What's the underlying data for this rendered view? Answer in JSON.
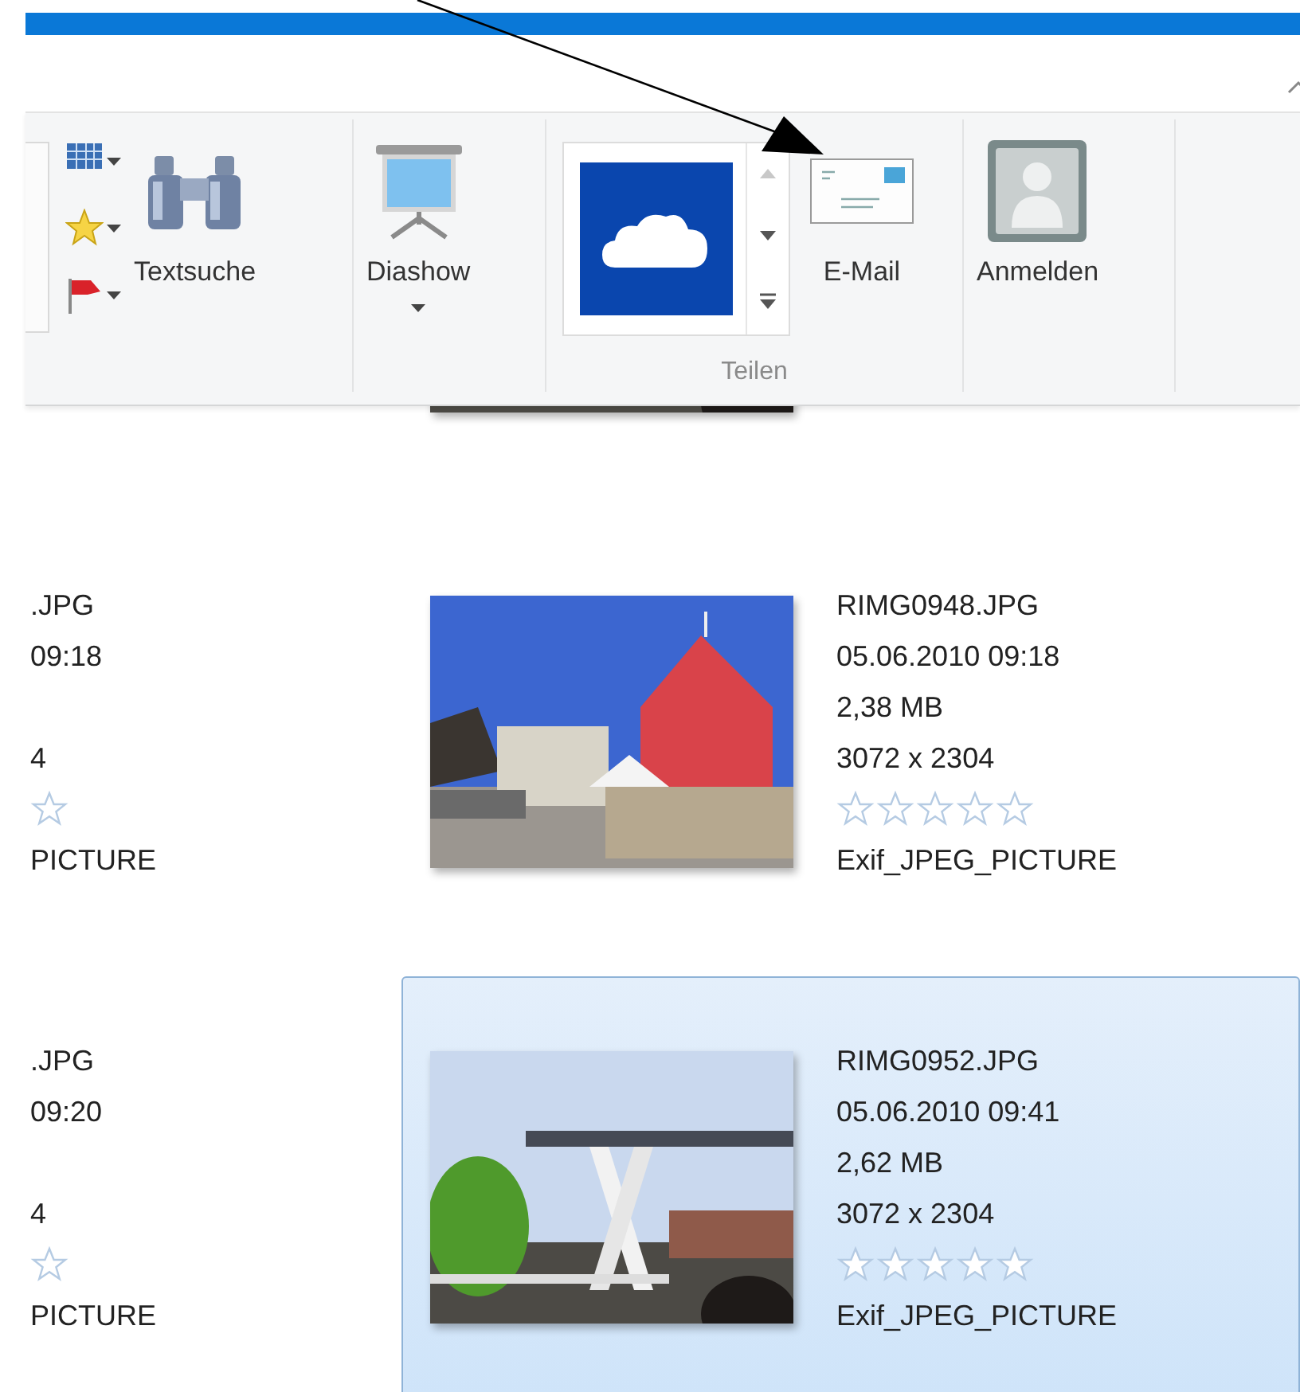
{
  "ribbon": {
    "groups": [
      {
        "kind": "tools",
        "buttons": [
          {
            "kind": "search",
            "label": "Textsuche",
            "dropdown": false
          }
        ]
      },
      {
        "kind": "slideshow",
        "buttons": [
          {
            "kind": "slideshow",
            "label": "Diashow",
            "dropdown": true
          }
        ]
      },
      {
        "kind": "share",
        "label": "Teilen",
        "buttons": [
          {
            "kind": "email",
            "label": "E-Mail",
            "dropdown": false
          }
        ]
      },
      {
        "kind": "account",
        "buttons": [
          {
            "kind": "signin",
            "label": "Anmelden",
            "dropdown": false
          }
        ]
      }
    ]
  },
  "rows": [
    {
      "items": [
        {
          "kind": "full",
          "selected": false
        }
      ]
    },
    {
      "items": [
        {
          "kind": "cut",
          "selected": false,
          "name": ".JPG",
          "date": "09:18",
          "dimensions": "4",
          "type": "PICTURE"
        },
        {
          "kind": "full",
          "selected": false,
          "name": "RIMG0948.JPG",
          "date": "05.06.2010 09:18",
          "size": "2,38 MB",
          "dimensions": "3072 x 2304",
          "stars": 0,
          "type": "Exif_JPEG_PICTURE"
        }
      ]
    },
    {
      "items": [
        {
          "kind": "cut",
          "selected": false,
          "name": ".JPG",
          "date": "09:20",
          "dimensions": "4",
          "type": "PICTURE"
        },
        {
          "kind": "full",
          "selected": true,
          "name": "RIMG0952.JPG",
          "date": "05.06.2010 09:41",
          "size": "2,62 MB",
          "dimensions": "3072 x 2304",
          "stars": 0,
          "type": "Exif_JPEG_PICTURE"
        }
      ]
    }
  ]
}
